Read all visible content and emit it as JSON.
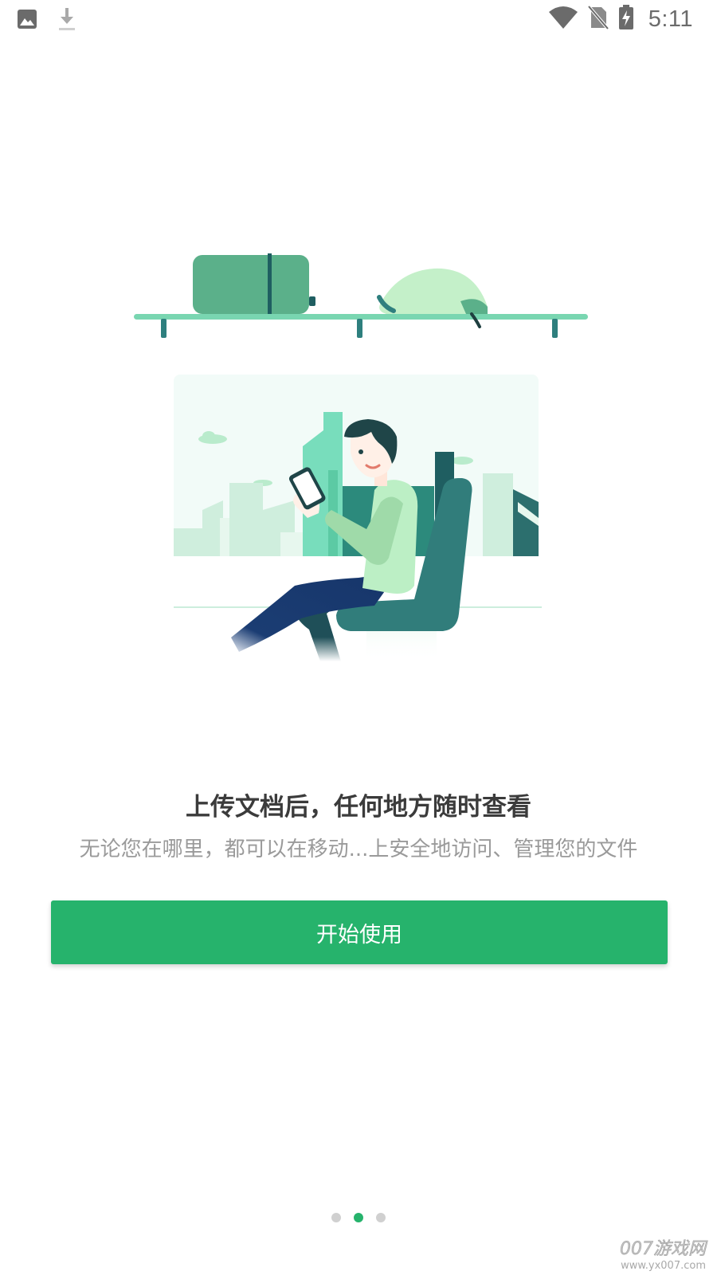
{
  "status_bar": {
    "time": "5:11",
    "left_icons": [
      "image-icon",
      "download-icon"
    ],
    "right_icons": [
      "wifi-icon",
      "no-sim-icon",
      "battery-charging-icon"
    ]
  },
  "onboarding": {
    "headline": "上传文档后，任何地方随时查看",
    "subline": "无论您在哪里，都可以在移动...上安全地访问、管理您的文件",
    "start_button": "开始使用",
    "page_count": 3,
    "active_page": 2
  },
  "watermark": {
    "brand": "007游戏网",
    "url": "www.yx007.com"
  },
  "colors": {
    "accent": "#26b36c",
    "headline": "#3b3b3b",
    "subline": "#9a9a9a",
    "dot_inactive": "#d0d0d0"
  }
}
